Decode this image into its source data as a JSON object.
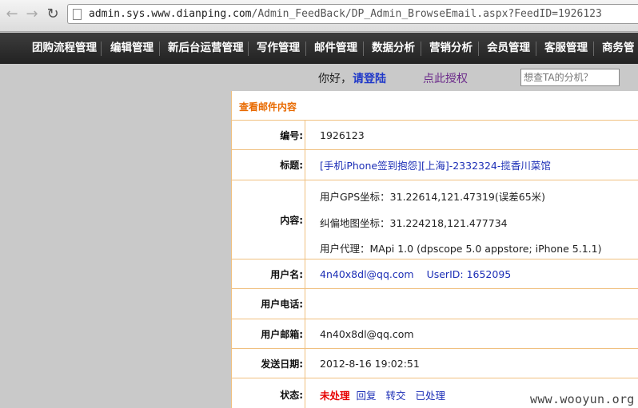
{
  "browser": {
    "url_host": "admin.sys.www.dianping.com",
    "url_path": "/Admin_FeedBack/DP_Admin_BrowseEmail.aspx?FeedID=1926123"
  },
  "nav": {
    "items": [
      "团购流程管理",
      "编辑管理",
      "新后台运营管理",
      "写作管理",
      "邮件管理",
      "数据分析",
      "营销分析",
      "会员管理",
      "客服管理",
      "商务管"
    ]
  },
  "greeting": {
    "hello": "你好，",
    "login": "请登陆",
    "authorize": "点此授权",
    "search_placeholder": "想查TA的分机？"
  },
  "panel": {
    "title": "查看邮件内容",
    "id_label": "编号:",
    "id_value": "1926123",
    "subject_label": "标题:",
    "subject_value": "[手机iPhone签到抱怨][上海]-2332324-揽香川菜馆",
    "content_label": "内容:",
    "content_line1": "用户GPS坐标：31.22614,121.47319(误差65米)",
    "content_line2": "纠偏地图坐标：31.224218,121.477734",
    "content_line3": "用户代理：MApi 1.0 (dpscope 5.0 appstore; iPhone 5.1.1)",
    "username_label": "用户名:",
    "username_value": "4n40x8dl@qq.com",
    "userid_value": "UserID: 1652095",
    "phone_label": "用户电话:",
    "phone_value": "",
    "email_label": "用户邮箱:",
    "email_value": "4n40x8dl@qq.com",
    "date_label": "发送日期:",
    "date_value": "2012-8-16 19:02:51",
    "status_label": "状态:",
    "status_unhandled": "未处理",
    "status_reply": "回复",
    "status_forward": "转交",
    "status_done": "已处理"
  },
  "watermark": "www.wooyun.org"
}
